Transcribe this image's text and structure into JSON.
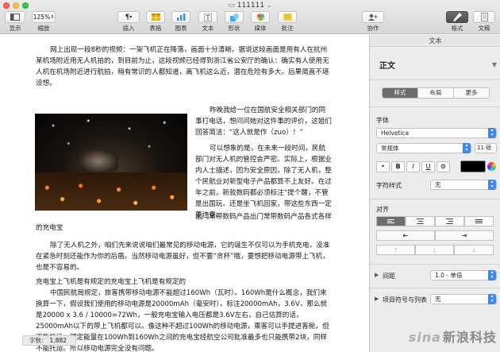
{
  "window": {
    "title": "111111",
    "title_chevron": "⌄"
  },
  "toolbar": {
    "display_label": "显示",
    "zoom_value": "125%",
    "zoom_label": "缩放",
    "insert_label": "插入",
    "table_label": "表格",
    "chart_label": "图表",
    "text_label": "文本",
    "shape_label": "形状",
    "media_label": "媒体",
    "comment_label": "批注",
    "collaborate_label": "协作",
    "format_label": "格式",
    "document_label": "文稿"
  },
  "document": {
    "paragraphs": [
      "网上出现一段8秒的视频：一架飞机正在降落，画面十分清晰。据说这段画面是用有人在杭州某机场附近用无人机拍的，到目前为止，这段视频已经得到浙江省公安厅的确认：确实有人使用无人机在机场附近进行航拍，稍有常识的人都知道，离飞机这么近，潜在危险有多大。后果简直不堪设想。",
      "昨晚我给一位在国航安全相关部门的同事打电话，想问问她对这件事的评价，这姐们回答简洁：“这人就是作（zuo）！”",
      "可以想象的是，在未来一段时间，民航部门对无人机的管控会严密。实际上，根据业内人士描述，因为安全原因，除了无人机，整个民航业对新型电子产品都算不上友好。在过年之前，新款数码都必须标注“提个醒，不管是出国玩、还是坐飞机回家，带这些东西一定要注意。",
      "出门常带数码产品出门常带数码产品各式各样的充电宝",
      "除了无人机之外，咱们先来说说咱们最常见的移动电源，它的诞生不仅可以为手机充电，没准在紧急时刻还能作为你的后盾。当然移动电源虽好，但不要“贪杯”哦，要想把移动电源带上飞机，也是不容易的。",
      "充电宝上飞机是有规定的充电宝上飞机是有规定的",
      "中国民航局规定，旅客携带移动电源不能超过160Wh（瓦时）。160Wh是什么概念，我们来换算一下，假设我们使用的移动电源是20000mAh（毫安时），标注20000mAh，3.6V，那么就是20000 x 3.6 / 10000=72Wh，一般充电宝输入电压都是3.6V左右，自己估算的话，25000mAh以下的带上飞机都可以。像这种不超过100Wh的移动电源，乘客可以手提进客舱，但不能托运；额定能量在100Wh到160Wh之间的充电宝经航空公司批准最多也只能携带2块，同样不能托运。所以移动电源完全没有问题。"
    ],
    "word_count_label": "字数:",
    "word_count_value": "1,882"
  },
  "sidebar": {
    "header": "文本",
    "paragraph_style": "正文",
    "tabs": [
      "样式",
      "布局",
      "更多"
    ],
    "active_tab": "样式",
    "font_section": "字体",
    "font_family": "Helvetica",
    "font_style": "常规体",
    "font_size": "11 磅",
    "fmt_buttons": [
      "•",
      "B",
      "I",
      "U",
      "⚙"
    ],
    "font_color": "#000000",
    "char_style_label": "字符样式",
    "char_style_value": "无",
    "align_section": "对齐",
    "spacing_label": "间距",
    "spacing_value": "1.0 - 单倍",
    "bullets_label": "项目符号与列表",
    "bullets_value": "无"
  },
  "watermark": {
    "brand": "sina",
    "text": "新浪科技"
  }
}
